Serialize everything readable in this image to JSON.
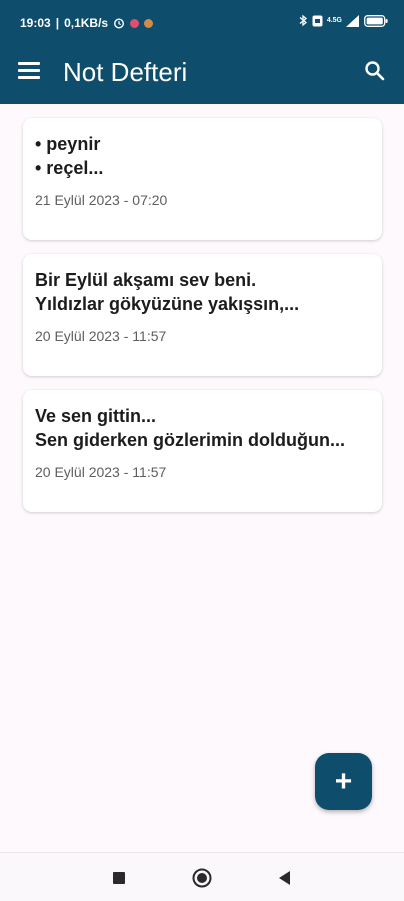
{
  "status_bar": {
    "time": "19:03",
    "speed": "0,1KB/s",
    "net": "4.5G"
  },
  "toolbar": {
    "title": "Not Defteri"
  },
  "notes": [
    {
      "line1": "• peynir",
      "line2": "• reçel...",
      "date": "21 Eylül 2023 - 07:20"
    },
    {
      "line1": "Bir Eylül akşamı sev beni.",
      "line2": "Yıldızlar gökyüzüne yakışsın,...",
      "date": "20 Eylül 2023 - 11:57"
    },
    {
      "line1": "Ve sen gittin...",
      "line2": "Sen giderken gözlerimin dolduğun...",
      "date": "20 Eylül 2023 - 11:57"
    }
  ],
  "fab": {
    "label": "+"
  },
  "colors": {
    "primary": "#0e4d6b",
    "background": "#fdf9fc"
  }
}
